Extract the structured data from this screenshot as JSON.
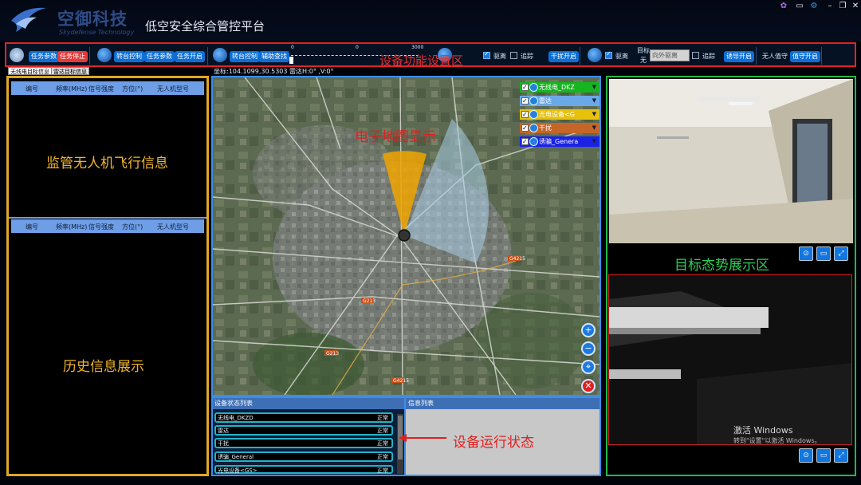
{
  "header": {
    "company_name": "空御科技",
    "company_en": "Skydefense Technology",
    "app_title": "低空安全综合管控平台",
    "window_controls": [
      "✿",
      "▭",
      "⚙",
      "–",
      "❐",
      "✕"
    ]
  },
  "toolbar": {
    "region_label": "设备功能设置区",
    "group1": {
      "task_params": "任务参数",
      "task_stop": "任务停止"
    },
    "group2": {
      "turret_control": "转台控制",
      "task_params": "任务参数",
      "task_start": "任务开启"
    },
    "group3": {
      "turret_control": "转台控制",
      "aux_search": "辅助查找"
    },
    "slider": {
      "min": "0",
      "mid": "0",
      "max": "3000"
    },
    "options_a": {
      "suppress": "驱离",
      "suppress_checked": true,
      "trap": "追踪",
      "trap_checked": false
    },
    "jam_start": "干扰开启",
    "options_b": {
      "suppress": "驱离",
      "suppress_checked": true
    },
    "target_label": "目标",
    "target_sub": "无",
    "target_input_placeholder": "向外驱离",
    "options_c": {
      "trap": "追踪",
      "trap_checked": false
    },
    "lure_start": "诱导开启",
    "drone_lure_label": "无人值守",
    "drone_lure_start": "值守开启"
  },
  "tabs": {
    "radio_targets": "无线电目标信息",
    "radar_targets": "雷达目标信息"
  },
  "coord_text": "坐标:104.1099,30.5303  雷达H:0° ,V:0°",
  "left_panel": {
    "columns": [
      "编号",
      "频率(MHz)",
      "信号强度",
      "方位(°)",
      "无人机型号"
    ],
    "top_caption": "监管无人机飞行信息",
    "bottom_caption": "历史信息展示"
  },
  "map": {
    "caption": "电子地图显示",
    "layers": [
      {
        "label": "无线电_DKZ",
        "color": "#15b51f"
      },
      {
        "label": "雷达",
        "color": "#6aa8e8"
      },
      {
        "label": "光电设备<G",
        "color": "#e8c10c"
      },
      {
        "label": "干扰",
        "color": "#c56528"
      },
      {
        "label": "诱骗_Genera",
        "color": "#1a22e8"
      }
    ],
    "road_labels": [
      "G4215",
      "G213",
      "G213",
      "G4215"
    ],
    "zoom_icons": [
      "zoom-in",
      "zoom-out",
      "locate",
      "close"
    ]
  },
  "device_panel": {
    "title": "设备状态列表",
    "rows": [
      {
        "name": "无线电_DKZD",
        "status": "正常"
      },
      {
        "name": "雷达",
        "status": "正常"
      },
      {
        "name": "干扰",
        "status": "正常"
      },
      {
        "name": "诱骗_General",
        "status": "正常"
      },
      {
        "name": "光电设备<GS>",
        "status": "正常"
      }
    ],
    "annotation": "设备运行状态"
  },
  "info_panel": {
    "title": "信息列表"
  },
  "right_panel": {
    "caption": "目标态势展示区",
    "activate_title": "激活 Windows",
    "activate_sub": "转到\"设置\"以激活 Windows。"
  },
  "colors": {
    "toolbar_border": "#e02424",
    "left_border": "#e0a722",
    "map_border": "#3d8de8",
    "right_border": "#22b84a",
    "button_blue": "#0d6fd6"
  }
}
